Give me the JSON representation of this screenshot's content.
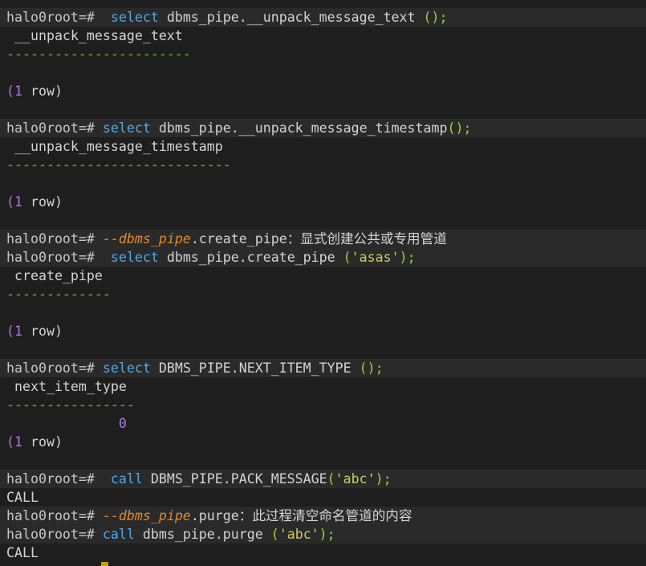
{
  "terminal": {
    "prompt": "halo0root=#",
    "lines": [
      {
        "kind": "cmd",
        "sp": "  ",
        "parts": [
          {
            "c": "kw",
            "t": "select"
          },
          {
            "c": "txt",
            "t": " dbms_pipe.__unpack_message_text "
          },
          {
            "c": "pn",
            "t": "();"
          }
        ]
      },
      {
        "kind": "out",
        "text": " __unpack_message_text"
      },
      {
        "kind": "dash",
        "text": "-----------------------"
      },
      {
        "kind": "blank"
      },
      {
        "kind": "rows",
        "open": "(",
        "num": "1",
        "rest": " row)"
      },
      {
        "kind": "blank"
      },
      {
        "kind": "cmd",
        "sp": " ",
        "parts": [
          {
            "c": "kw",
            "t": "select"
          },
          {
            "c": "txt",
            "t": " dbms_pipe.__unpack_message_timestamp"
          },
          {
            "c": "pn",
            "t": "();"
          }
        ]
      },
      {
        "kind": "out",
        "text": " __unpack_message_timestamp"
      },
      {
        "kind": "dash",
        "text": "----------------------------"
      },
      {
        "kind": "blank"
      },
      {
        "kind": "rows",
        "open": "(",
        "num": "1",
        "rest": " row)"
      },
      {
        "kind": "blank"
      },
      {
        "kind": "cmd",
        "sp": " ",
        "parts": [
          {
            "c": "cm",
            "t": "--dbms_pipe"
          },
          {
            "c": "txt",
            "t": ".create_pipe"
          },
          {
            "c": "cjk",
            "t": "：显式创建公共或专用管道"
          }
        ]
      },
      {
        "kind": "cmd",
        "sp": "  ",
        "parts": [
          {
            "c": "kw",
            "t": "select"
          },
          {
            "c": "txt",
            "t": " dbms_pipe.create_pipe "
          },
          {
            "c": "pn",
            "t": "("
          },
          {
            "c": "str",
            "t": "'asas'"
          },
          {
            "c": "pn",
            "t": ");"
          }
        ]
      },
      {
        "kind": "out",
        "text": " create_pipe"
      },
      {
        "kind": "dash",
        "text": "-------------"
      },
      {
        "kind": "blank"
      },
      {
        "kind": "rows",
        "open": "(",
        "num": "1",
        "rest": " row)"
      },
      {
        "kind": "blank"
      },
      {
        "kind": "cmd",
        "sp": " ",
        "parts": [
          {
            "c": "kw",
            "t": "select"
          },
          {
            "c": "txt",
            "t": " DBMS_PIPE.NEXT_ITEM_TYPE "
          },
          {
            "c": "pn",
            "t": "();"
          }
        ]
      },
      {
        "kind": "out",
        "text": " next_item_type"
      },
      {
        "kind": "dash",
        "text": "----------------"
      },
      {
        "kind": "num",
        "pad": "              ",
        "num": "0"
      },
      {
        "kind": "rows",
        "open": "(",
        "num": "1",
        "rest": " row)"
      },
      {
        "kind": "blank"
      },
      {
        "kind": "cmd",
        "sp": "  ",
        "parts": [
          {
            "c": "kw",
            "t": "call"
          },
          {
            "c": "txt",
            "t": " DBMS_PIPE.PACK_MESSAGE"
          },
          {
            "c": "pn",
            "t": "("
          },
          {
            "c": "str",
            "t": "'abc'"
          },
          {
            "c": "pn",
            "t": ");"
          }
        ]
      },
      {
        "kind": "out",
        "text": "CALL"
      },
      {
        "kind": "cmd",
        "sp": " ",
        "parts": [
          {
            "c": "cm",
            "t": "--dbms_pipe"
          },
          {
            "c": "txt",
            "t": ".purge"
          },
          {
            "c": "cjk",
            "t": "：此过程清空命名管道的内容"
          }
        ]
      },
      {
        "kind": "cmd",
        "sp": " ",
        "parts": [
          {
            "c": "kw",
            "t": "call"
          },
          {
            "c": "txt",
            "t": " dbms_pipe.purge "
          },
          {
            "c": "pn",
            "t": "("
          },
          {
            "c": "str",
            "t": "'abc'"
          },
          {
            "c": "pn",
            "t": ");"
          }
        ]
      },
      {
        "kind": "out",
        "text": "CALL"
      }
    ]
  },
  "colors": {
    "background": "#1e1e1e",
    "prompt_band": "#2a2a2a",
    "keyword": "#52a6e5",
    "comment": "#e08a2d",
    "string": "#c8cf61",
    "punct": "#a6cf2a",
    "number": "#b078e0",
    "separator": "#82b22f",
    "cursor": "#c8a000"
  }
}
